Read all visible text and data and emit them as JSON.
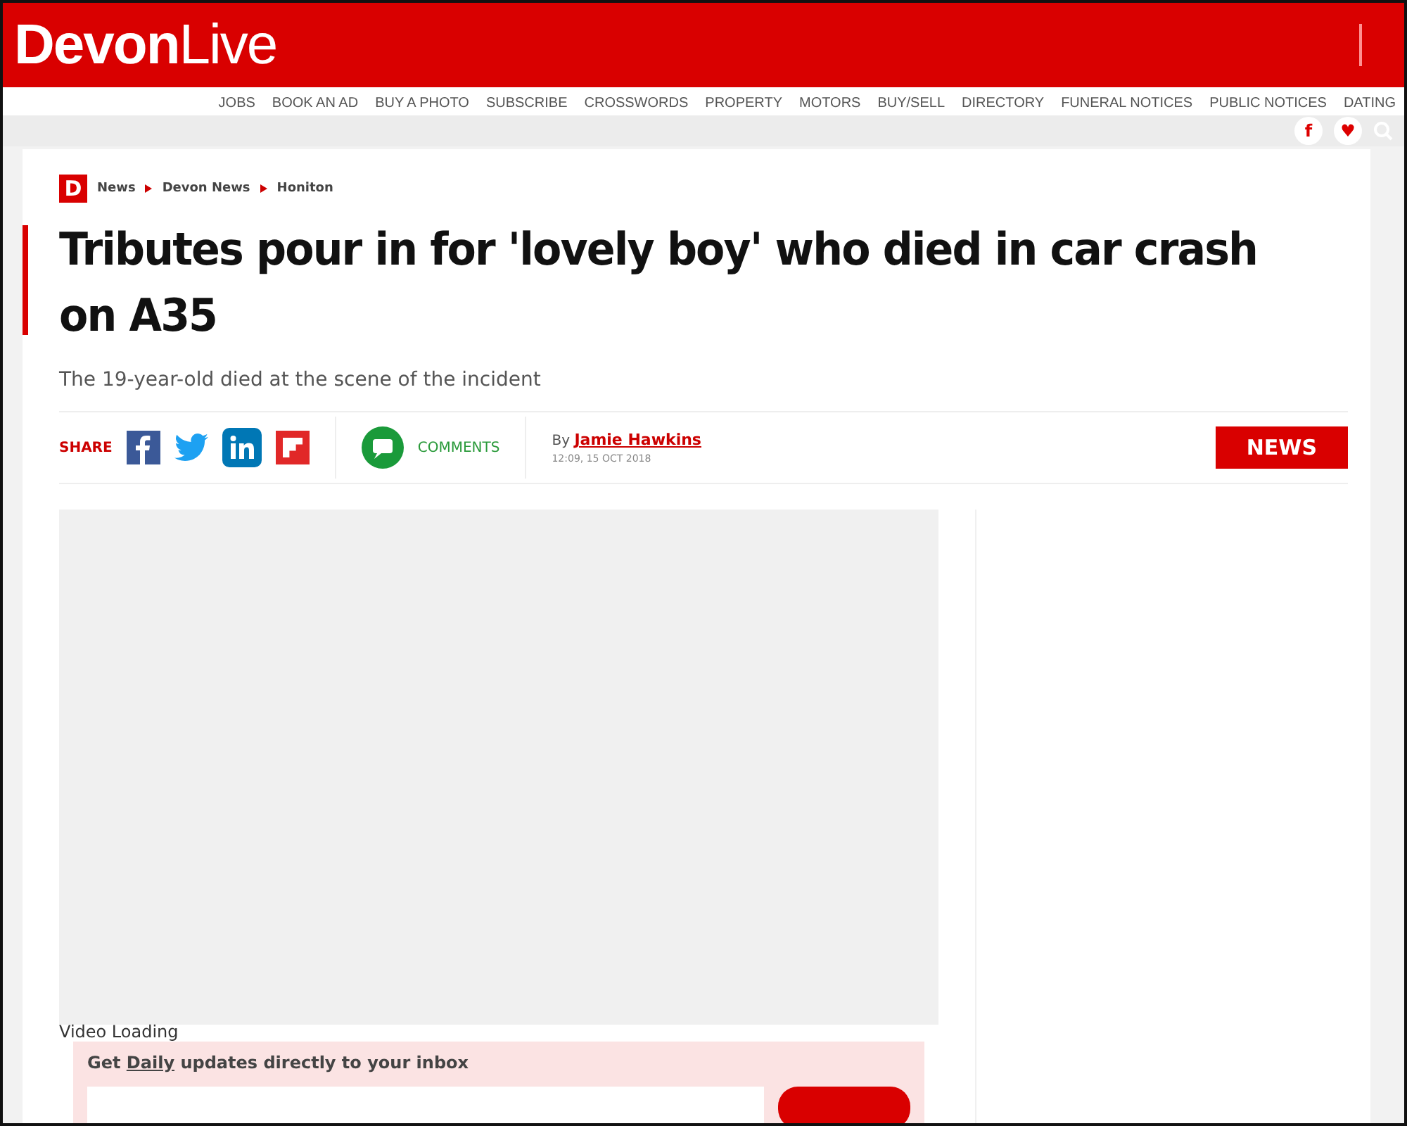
{
  "header": {
    "logo_bold": "Devon",
    "logo_light": "Live"
  },
  "top_links": [
    "JOBS",
    "BOOK AN AD",
    "BUY A PHOTO",
    "SUBSCRIBE",
    "CROSSWORDS",
    "PROPERTY",
    "MOTORS",
    "BUY/SELL",
    "DIRECTORY",
    "FUNERAL NOTICES",
    "PUBLIC NOTICES",
    "DATING"
  ],
  "social": [
    "f",
    "♥"
  ],
  "breadcrumb": {
    "logo": "D",
    "items": [
      "News",
      "Devon News",
      "Honiton"
    ]
  },
  "headline": "Tributes pour in for 'lovely boy' who died in car crash on A35",
  "standfirst": "The 19-year-old died at the scene of the incident",
  "share": {
    "label": "SHARE",
    "comments": "COMMENTS",
    "by": "By",
    "author": "Jamie Hawkins",
    "time": "12:09, 15 OCT 2018",
    "section": "NEWS"
  },
  "video": {
    "status": "Video Loading"
  },
  "newsletter": {
    "before": "Get ",
    "link": "Daily",
    "after": " updates directly to your inbox"
  }
}
